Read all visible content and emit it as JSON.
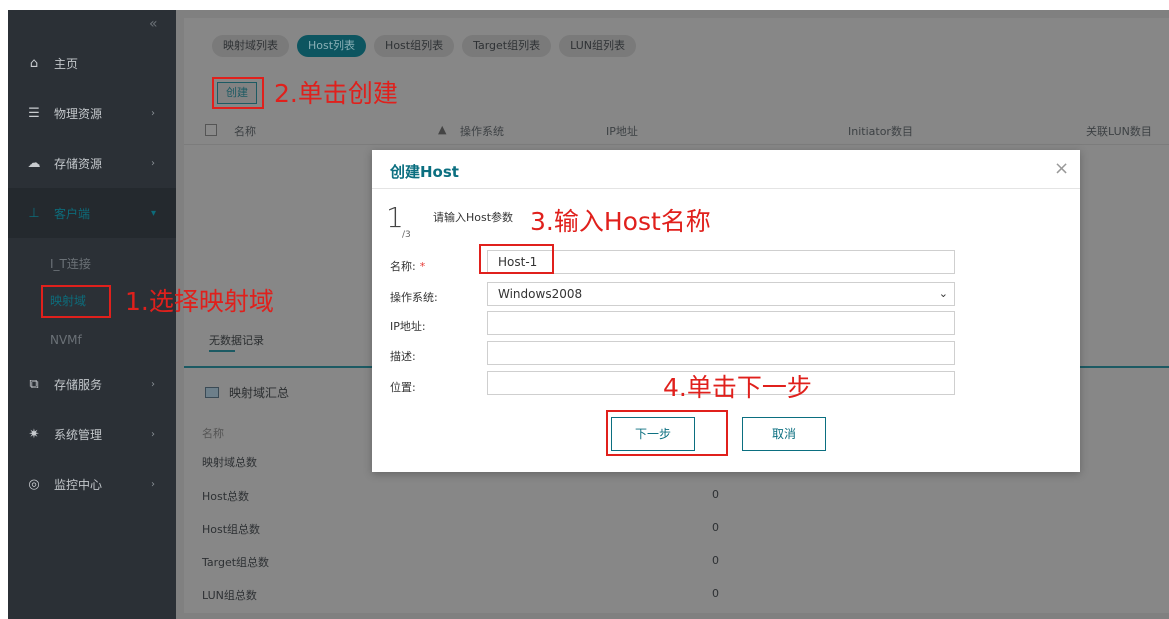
{
  "sidebar": {
    "collapse_glyph": "«",
    "items": [
      {
        "label": "主页",
        "icon": "home-icon"
      },
      {
        "label": "物理资源",
        "icon": "server-icon"
      },
      {
        "label": "存储资源",
        "icon": "cloud-icon"
      },
      {
        "label": "客户端",
        "icon": "network-icon"
      },
      {
        "label": "存储服务",
        "icon": "copy-icon"
      },
      {
        "label": "系统管理",
        "icon": "gear-icon"
      },
      {
        "label": "监控中心",
        "icon": "dashboard-icon"
      }
    ],
    "sub_items": [
      {
        "label": "I_T连接"
      },
      {
        "label": "映射域"
      },
      {
        "label": "NVMf"
      }
    ]
  },
  "tabs": [
    {
      "label": "映射域列表"
    },
    {
      "label": "Host列表"
    },
    {
      "label": "Host组列表"
    },
    {
      "label": "Target组列表"
    },
    {
      "label": "LUN组列表"
    }
  ],
  "toolbar": {
    "create_label": "创建"
  },
  "table": {
    "headers": [
      "名称",
      "操作系统",
      "IP地址",
      "Initiator数目",
      "关联LUN数目"
    ]
  },
  "empty_text": "无数据记录",
  "summary": {
    "title": "映射域汇总",
    "header": "名称",
    "rows": [
      {
        "label": "映射域总数",
        "value": ""
      },
      {
        "label": "Host总数",
        "value": "0"
      },
      {
        "label": "Host组总数",
        "value": "0"
      },
      {
        "label": "Target组总数",
        "value": "0"
      },
      {
        "label": "LUN组总数",
        "value": "0"
      }
    ]
  },
  "modal": {
    "title": "创建Host",
    "close_glyph": "×",
    "step": "1",
    "step_total": "/3",
    "step_desc": "请输入Host参数",
    "fields": {
      "name_label": "名称:",
      "name_required": "*",
      "name_value": "Host-1",
      "os_label": "操作系统:",
      "os_value": "Windows2008",
      "ip_label": "IP地址:",
      "desc_label": "描述:",
      "location_label": "位置:"
    },
    "next_label": "下一步",
    "cancel_label": "取消"
  },
  "annotations": {
    "a1": "1.选择映射域",
    "a2": "2.单击创建",
    "a3": "3.输入Host名称",
    "a4": "4.单击下一步"
  },
  "colors": {
    "accent": "#0b6f80",
    "annotation": "#e0201c",
    "sidebar": "#2b3036"
  }
}
